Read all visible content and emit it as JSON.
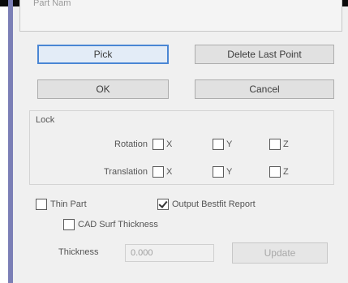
{
  "top_field": {
    "ghost_text": "Part Nam"
  },
  "buttons": {
    "pick": "Pick",
    "delete_last_point": "Delete Last Point",
    "ok": "OK",
    "cancel": "Cancel",
    "update": "Update"
  },
  "lock": {
    "title": "Lock",
    "rotation": {
      "label": "Rotation",
      "x": {
        "label": "X",
        "checked": false
      },
      "y": {
        "label": "Y",
        "checked": false
      },
      "z": {
        "label": "Z",
        "checked": false
      }
    },
    "translation": {
      "label": "Translation",
      "x": {
        "label": "X",
        "checked": false
      },
      "y": {
        "label": "Y",
        "checked": false
      },
      "z": {
        "label": "Z",
        "checked": false
      }
    }
  },
  "options": {
    "thin_part": {
      "label": "Thin Part",
      "checked": false
    },
    "output_bestfit_report": {
      "label": "Output Bestfit Report",
      "checked": true
    },
    "cad_surf_thickness": {
      "label": "CAD Surf Thickness",
      "checked": false
    }
  },
  "thickness": {
    "label": "Thickness",
    "value": "0.000"
  },
  "colors": {
    "accent_bar": "#7b7fb6",
    "default_button_border": "#4a86d4",
    "dialog_bg": "#f0f0f0"
  }
}
